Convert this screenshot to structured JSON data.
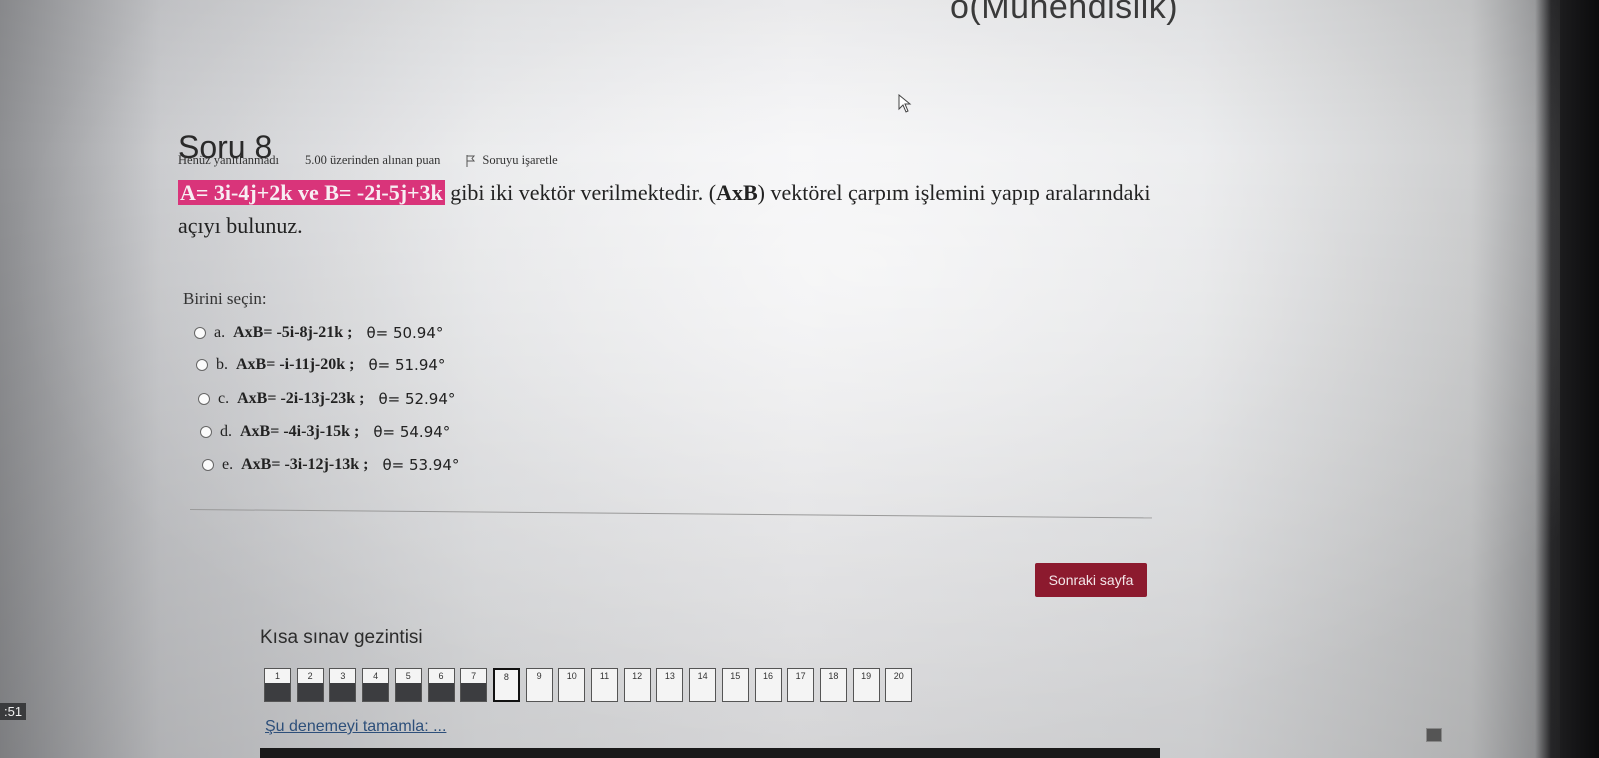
{
  "header": {
    "course_title_fragment": "o(Mühendislik)"
  },
  "taskbar": {
    "time_fragment": ":51"
  },
  "question": {
    "heading": "Soru 8",
    "status": "Henüz yanıtlanmadı",
    "points": "5.00 üzerinden alınan puan",
    "flag_label": "Soruyu işaretle",
    "text_part_a": "A= 3i-4j+2k ve B= -2i-5j+3k",
    "text_part_b": " gibi iki vektör verilmektedir. (",
    "text_bold": "AxB",
    "text_part_c": ") vektörel çarpım işlemini yapıp aralarındaki açıyı bulunuz.",
    "choose_label": "Birini seçin:",
    "answers": [
      {
        "letter": "a.",
        "expr": "AxB= -5i-8j-21k ;",
        "theta": "θ= 50.94°"
      },
      {
        "letter": "b.",
        "expr": "AxB= -i-11j-20k ;",
        "theta": "θ= 51.94°"
      },
      {
        "letter": "c.",
        "expr": "AxB= -2i-13j-23k ;",
        "theta": "θ= 52.94°"
      },
      {
        "letter": "d.",
        "expr": "AxB= -4i-3j-15k ;",
        "theta": "θ= 54.94°"
      },
      {
        "letter": "e.",
        "expr": "AxB= -3i-12j-13k ;",
        "theta": "θ= 53.94°"
      }
    ]
  },
  "next_button": {
    "label": "Sonraki sayfa"
  },
  "quiz_nav": {
    "title": "Kısa sınav gezintisi",
    "buttons": [
      "1",
      "2",
      "3",
      "4",
      "5",
      "6",
      "7",
      "8",
      "9",
      "10",
      "11",
      "12",
      "13",
      "14",
      "15",
      "16",
      "17",
      "18",
      "19",
      "20"
    ],
    "answered_count": 7,
    "current": "8",
    "finish_link": "Şu denemeyi tamamla: ..."
  }
}
